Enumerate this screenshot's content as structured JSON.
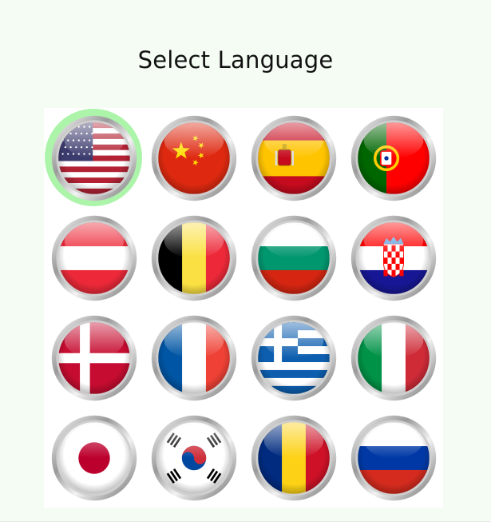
{
  "title": "Select Language",
  "selected": "us",
  "flags": [
    {
      "id": "us",
      "icon": "flag-usa-icon",
      "colors": [
        "#b22234",
        "#ffffff",
        "#3c3b6e"
      ]
    },
    {
      "id": "cn",
      "icon": "flag-china-icon",
      "colors": [
        "#de2910",
        "#ffde00"
      ]
    },
    {
      "id": "es",
      "icon": "flag-spain-icon",
      "colors": [
        "#c60b1e",
        "#ffc400"
      ]
    },
    {
      "id": "pt",
      "icon": "flag-portugal-icon",
      "colors": [
        "#006600",
        "#ff0000",
        "#ffcc00"
      ]
    },
    {
      "id": "at",
      "icon": "flag-austria-icon",
      "colors": [
        "#ed2939",
        "#ffffff",
        "#ed2939"
      ]
    },
    {
      "id": "be",
      "icon": "flag-belgium-icon",
      "colors": [
        "#000000",
        "#fae042",
        "#ed2939"
      ]
    },
    {
      "id": "bg",
      "icon": "flag-bulgaria-icon",
      "colors": [
        "#ffffff",
        "#00966e",
        "#d62612"
      ]
    },
    {
      "id": "hr",
      "icon": "flag-croatia-icon",
      "colors": [
        "#ff0000",
        "#ffffff",
        "#171796"
      ]
    },
    {
      "id": "dk",
      "icon": "flag-denmark-icon",
      "colors": [
        "#c60c30",
        "#ffffff"
      ]
    },
    {
      "id": "fr",
      "icon": "flag-france-icon",
      "colors": [
        "#0055a4",
        "#ffffff",
        "#ef4135"
      ]
    },
    {
      "id": "gr",
      "icon": "flag-greece-icon",
      "colors": [
        "#0d5eaf",
        "#ffffff"
      ]
    },
    {
      "id": "it",
      "icon": "flag-italy-icon",
      "colors": [
        "#009246",
        "#ffffff",
        "#ce2b37"
      ]
    },
    {
      "id": "jp",
      "icon": "flag-japan-icon",
      "colors": [
        "#ffffff",
        "#bc002d"
      ]
    },
    {
      "id": "kr",
      "icon": "flag-south-korea-icon",
      "colors": [
        "#ffffff",
        "#cd2e3a",
        "#0047a0",
        "#000000"
      ]
    },
    {
      "id": "ro",
      "icon": "flag-romania-icon",
      "colors": [
        "#002b7f",
        "#fcd116",
        "#ce1126"
      ]
    },
    {
      "id": "ru",
      "icon": "flag-russia-icon",
      "colors": [
        "#ffffff",
        "#0039a6",
        "#d52b1e"
      ]
    }
  ]
}
